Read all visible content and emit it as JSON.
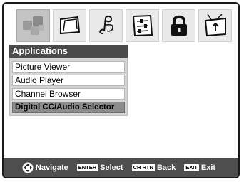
{
  "tabs": [
    {
      "icon": "applications-squares-icon",
      "active": true
    },
    {
      "icon": "picture-frame-icon",
      "active": false
    },
    {
      "icon": "music-note-icon",
      "active": false
    },
    {
      "icon": "settings-sliders-icon",
      "active": false
    },
    {
      "icon": "lock-icon",
      "active": false
    },
    {
      "icon": "input-antenna-icon",
      "active": false
    }
  ],
  "menu": {
    "title": "Applications",
    "items": [
      {
        "label": "Picture Viewer"
      },
      {
        "label": "Audio Player"
      },
      {
        "label": "Channel Browser"
      },
      {
        "label": "Digital CC/Audio Selector",
        "selected": true
      }
    ]
  },
  "footer": {
    "navigate_label": "Navigate",
    "enter_key": "ENTER",
    "select_label": "Select",
    "chrtn_key": "CH RTN",
    "back_label": "Back",
    "exit_key": "EXIT",
    "exit_label": "Exit"
  },
  "colors": {
    "title_bar": "#4a4a4a",
    "footer": "#4e4e4e",
    "selected_item": "#8c8c8c",
    "active_tab": "#c3c3c3"
  }
}
